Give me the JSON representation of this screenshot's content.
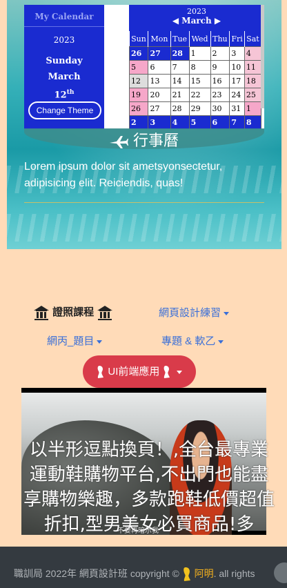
{
  "calendar": {
    "sidebar_title": "My Calendar",
    "year": "2023",
    "weekday": "Sunday",
    "month": "March",
    "day": "12",
    "day_suffix": "th",
    "change_theme": "Change Theme",
    "header_year": "2023",
    "header_month": "March",
    "prev_icon": "triangle-left-icon",
    "next_icon": "triangle-right-icon",
    "weekdays": [
      "Sun",
      "Mon",
      "Tue",
      "Wed",
      "Thu",
      "Fri",
      "Sat"
    ],
    "weeks": [
      [
        "26",
        "27",
        "28",
        "1",
        "2",
        "3",
        "4"
      ],
      [
        "5",
        "6",
        "7",
        "8",
        "9",
        "10",
        "11"
      ],
      [
        "12",
        "13",
        "14",
        "15",
        "16",
        "17",
        "18"
      ],
      [
        "19",
        "20",
        "21",
        "22",
        "23",
        "24",
        "25"
      ],
      [
        "26",
        "27",
        "28",
        "29",
        "30",
        "31",
        "1"
      ],
      [
        "2",
        "3",
        "4",
        "5",
        "6",
        "7",
        "8"
      ]
    ]
  },
  "hero": {
    "event_title": "行事曆",
    "lorem": "Lorem ipsum dolor sit ametsyonsectetur, adipisicing elit. Reiciendis, quas!"
  },
  "nav": {
    "cert": "證照課程",
    "web_practice": "網頁設計練習",
    "c_topics": "網丙_題目",
    "projects": "專題 & 軟乙",
    "ui_frontend": "UI前端應用"
  },
  "video": {
    "marquee": "以半形逗點換頁！,全台最專業運動鞋購物平台,不出門也能盡享購物樂趣，多款跑鞋低價超值折扣,型男美女必買商品!多",
    "caption": "不要再暗示我"
  },
  "footer": {
    "text": "職訓局 2022年 網頁設計班 copyright ©",
    "author": "阿明",
    "rights": ". all rights"
  }
}
